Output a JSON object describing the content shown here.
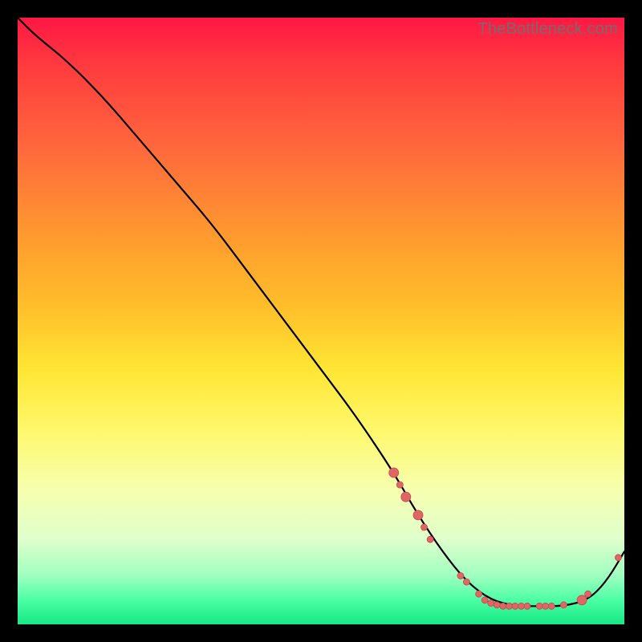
{
  "watermark": "TheBottleneck.com",
  "colors": {
    "curve": "#000000",
    "dot_fill": "#e06666",
    "dot_stroke": "#c24a4a",
    "gradient": [
      "#ff1744",
      "#ff3b3f",
      "#ff6a3c",
      "#ff9a2e",
      "#ffc02a",
      "#ffe634",
      "#fff86b",
      "#f6ffb0",
      "#dfffcc",
      "#9fffc0",
      "#4bffa5",
      "#17e884"
    ]
  },
  "chart_data": {
    "type": "line",
    "title": "",
    "xlabel": "",
    "ylabel": "",
    "xlim": [
      0,
      100
    ],
    "ylim": [
      0,
      100
    ],
    "grid": false,
    "legend": false,
    "series": [
      {
        "name": "bottleneck-curve",
        "x": [
          0,
          3,
          8,
          14,
          20,
          26,
          32,
          38,
          44,
          50,
          56,
          62,
          66,
          70,
          74,
          78,
          82,
          86,
          90,
          94,
          97,
          100
        ],
        "y": [
          100,
          97,
          93,
          87,
          80,
          73,
          66,
          58,
          50,
          42,
          34,
          25,
          18,
          12,
          7,
          4,
          3,
          3,
          3,
          4,
          7,
          12
        ]
      }
    ],
    "markers": [
      {
        "x": 62,
        "y": 25,
        "r": 6
      },
      {
        "x": 63,
        "y": 23,
        "r": 4
      },
      {
        "x": 64,
        "y": 21,
        "r": 6
      },
      {
        "x": 66,
        "y": 18,
        "r": 6
      },
      {
        "x": 67,
        "y": 16,
        "r": 4
      },
      {
        "x": 68,
        "y": 14,
        "r": 4
      },
      {
        "x": 73,
        "y": 8,
        "r": 4
      },
      {
        "x": 74,
        "y": 7,
        "r": 4
      },
      {
        "x": 76,
        "y": 5,
        "r": 4
      },
      {
        "x": 77,
        "y": 4,
        "r": 4
      },
      {
        "x": 78,
        "y": 3.5,
        "r": 4
      },
      {
        "x": 79,
        "y": 3.2,
        "r": 4
      },
      {
        "x": 80,
        "y": 3,
        "r": 4
      },
      {
        "x": 81,
        "y": 3,
        "r": 4
      },
      {
        "x": 82,
        "y": 3,
        "r": 4
      },
      {
        "x": 83,
        "y": 3,
        "r": 4
      },
      {
        "x": 84,
        "y": 3,
        "r": 4
      },
      {
        "x": 86,
        "y": 3,
        "r": 4
      },
      {
        "x": 87,
        "y": 3,
        "r": 4
      },
      {
        "x": 88,
        "y": 3,
        "r": 4
      },
      {
        "x": 90,
        "y": 3.2,
        "r": 4
      },
      {
        "x": 93,
        "y": 4,
        "r": 6
      },
      {
        "x": 94,
        "y": 5,
        "r": 4
      },
      {
        "x": 99,
        "y": 11,
        "r": 4
      }
    ]
  }
}
